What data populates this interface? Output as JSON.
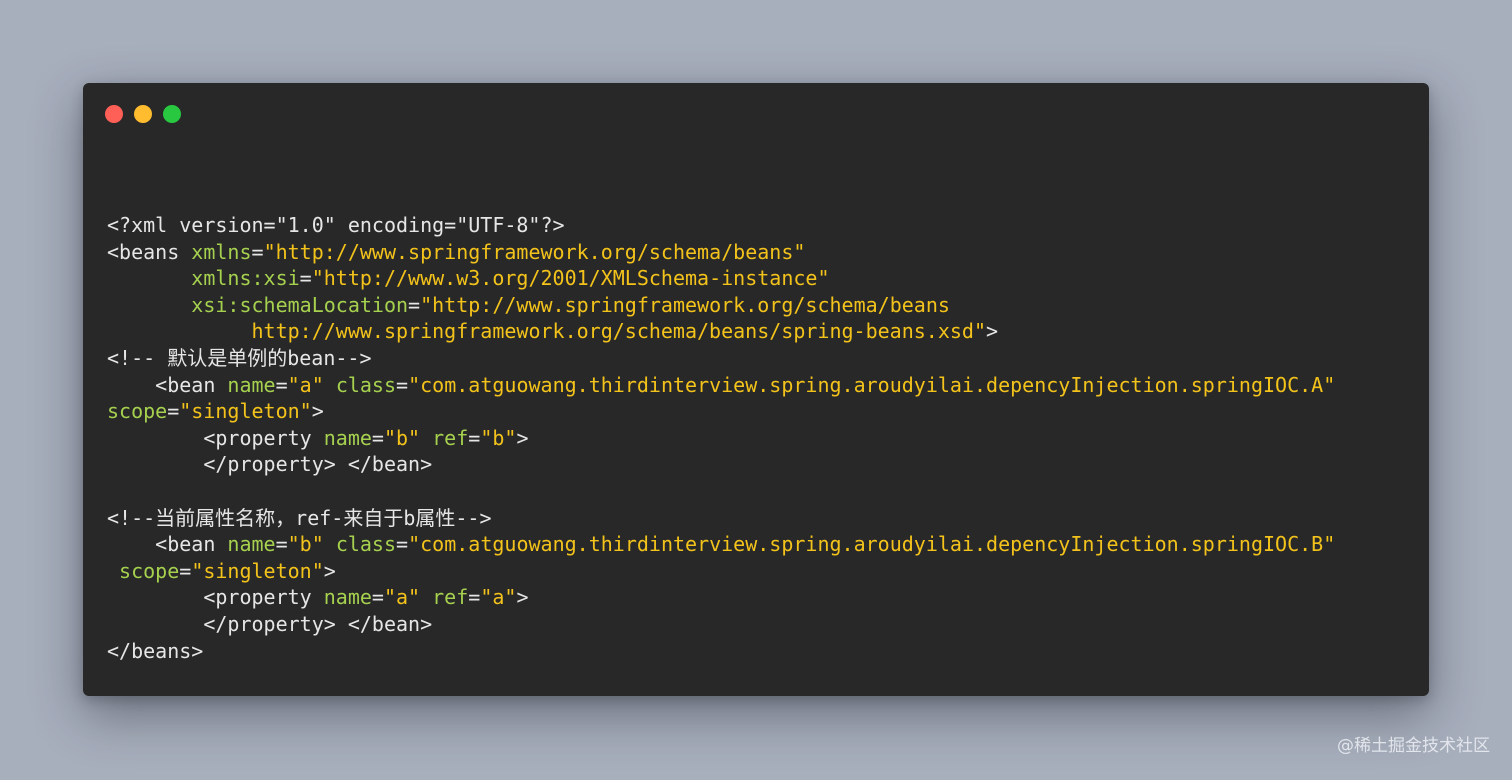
{
  "window_controls": {
    "close_color": "#fe5f57",
    "minimize_color": "#febc2e",
    "zoom_color": "#28c840"
  },
  "colors": {
    "background": "#a7aebc",
    "editor_background": "#282828",
    "text": "#e6e6e6",
    "attribute": "#a6d14f",
    "string": "#f3c31b"
  },
  "code": {
    "lines": [
      [
        {
          "text": "<?xml version=\"1.0\" encoding=\"UTF-8\"?>",
          "type": "tag"
        }
      ],
      [
        {
          "text": "<beans ",
          "type": "tag"
        },
        {
          "text": "xmlns",
          "type": "attr"
        },
        {
          "text": "=",
          "type": "tag"
        },
        {
          "text": "\"http://www.springframework.org/schema/beans\"",
          "type": "str"
        }
      ],
      [
        {
          "text": "       ",
          "type": "tag"
        },
        {
          "text": "xmlns:xsi",
          "type": "attr"
        },
        {
          "text": "=",
          "type": "tag"
        },
        {
          "text": "\"http://www.w3.org/2001/XMLSchema-instance\"",
          "type": "str"
        }
      ],
      [
        {
          "text": "       ",
          "type": "tag"
        },
        {
          "text": "xsi:schemaLocation",
          "type": "attr"
        },
        {
          "text": "=",
          "type": "tag"
        },
        {
          "text": "\"http://www.springframework.org/schema/beans",
          "type": "str"
        }
      ],
      [
        {
          "text": "            ",
          "type": "tag"
        },
        {
          "text": "http://www.springframework.org/schema/beans/spring-beans.xsd\"",
          "type": "str"
        },
        {
          "text": ">",
          "type": "tag"
        }
      ],
      [
        {
          "text": "<!-- 默认是单例的bean-->",
          "type": "comment"
        }
      ],
      [
        {
          "text": "    <bean ",
          "type": "tag"
        },
        {
          "text": "name",
          "type": "attr"
        },
        {
          "text": "=",
          "type": "tag"
        },
        {
          "text": "\"a\"",
          "type": "str"
        },
        {
          "text": " ",
          "type": "tag"
        },
        {
          "text": "class",
          "type": "attr"
        },
        {
          "text": "=",
          "type": "tag"
        },
        {
          "text": "\"com.atguowang.thirdinterview.spring.aroudyilai.depencyInjection.springIOC.A\"",
          "type": "str"
        }
      ],
      [
        {
          "text": "scope",
          "type": "attr"
        },
        {
          "text": "=",
          "type": "tag"
        },
        {
          "text": "\"singleton\"",
          "type": "str"
        },
        {
          "text": ">",
          "type": "tag"
        }
      ],
      [
        {
          "text": "        <property ",
          "type": "tag"
        },
        {
          "text": "name",
          "type": "attr"
        },
        {
          "text": "=",
          "type": "tag"
        },
        {
          "text": "\"b\"",
          "type": "str"
        },
        {
          "text": " ",
          "type": "tag"
        },
        {
          "text": "ref",
          "type": "attr"
        },
        {
          "text": "=",
          "type": "tag"
        },
        {
          "text": "\"b\"",
          "type": "str"
        },
        {
          "text": ">",
          "type": "tag"
        }
      ],
      [
        {
          "text": "        </property> </bean>",
          "type": "tag"
        }
      ],
      [],
      [
        {
          "text": "<!--当前属性名称，ref-来自于b属性-->",
          "type": "comment"
        }
      ],
      [
        {
          "text": "    <bean ",
          "type": "tag"
        },
        {
          "text": "name",
          "type": "attr"
        },
        {
          "text": "=",
          "type": "tag"
        },
        {
          "text": "\"b\"",
          "type": "str"
        },
        {
          "text": " ",
          "type": "tag"
        },
        {
          "text": "class",
          "type": "attr"
        },
        {
          "text": "=",
          "type": "tag"
        },
        {
          "text": "\"com.atguowang.thirdinterview.spring.aroudyilai.depencyInjection.springIOC.B\"",
          "type": "str"
        }
      ],
      [
        {
          "text": " ",
          "type": "tag"
        },
        {
          "text": "scope",
          "type": "attr"
        },
        {
          "text": "=",
          "type": "tag"
        },
        {
          "text": "\"singleton\"",
          "type": "str"
        },
        {
          "text": ">",
          "type": "tag"
        }
      ],
      [
        {
          "text": "        <property ",
          "type": "tag"
        },
        {
          "text": "name",
          "type": "attr"
        },
        {
          "text": "=",
          "type": "tag"
        },
        {
          "text": "\"a\"",
          "type": "str"
        },
        {
          "text": " ",
          "type": "tag"
        },
        {
          "text": "ref",
          "type": "attr"
        },
        {
          "text": "=",
          "type": "tag"
        },
        {
          "text": "\"a\"",
          "type": "str"
        },
        {
          "text": ">",
          "type": "tag"
        }
      ],
      [
        {
          "text": "        </property> </bean>",
          "type": "tag"
        }
      ],
      [
        {
          "text": "</beans>",
          "type": "tag"
        }
      ]
    ]
  },
  "watermark": "@稀土掘金技术社区"
}
